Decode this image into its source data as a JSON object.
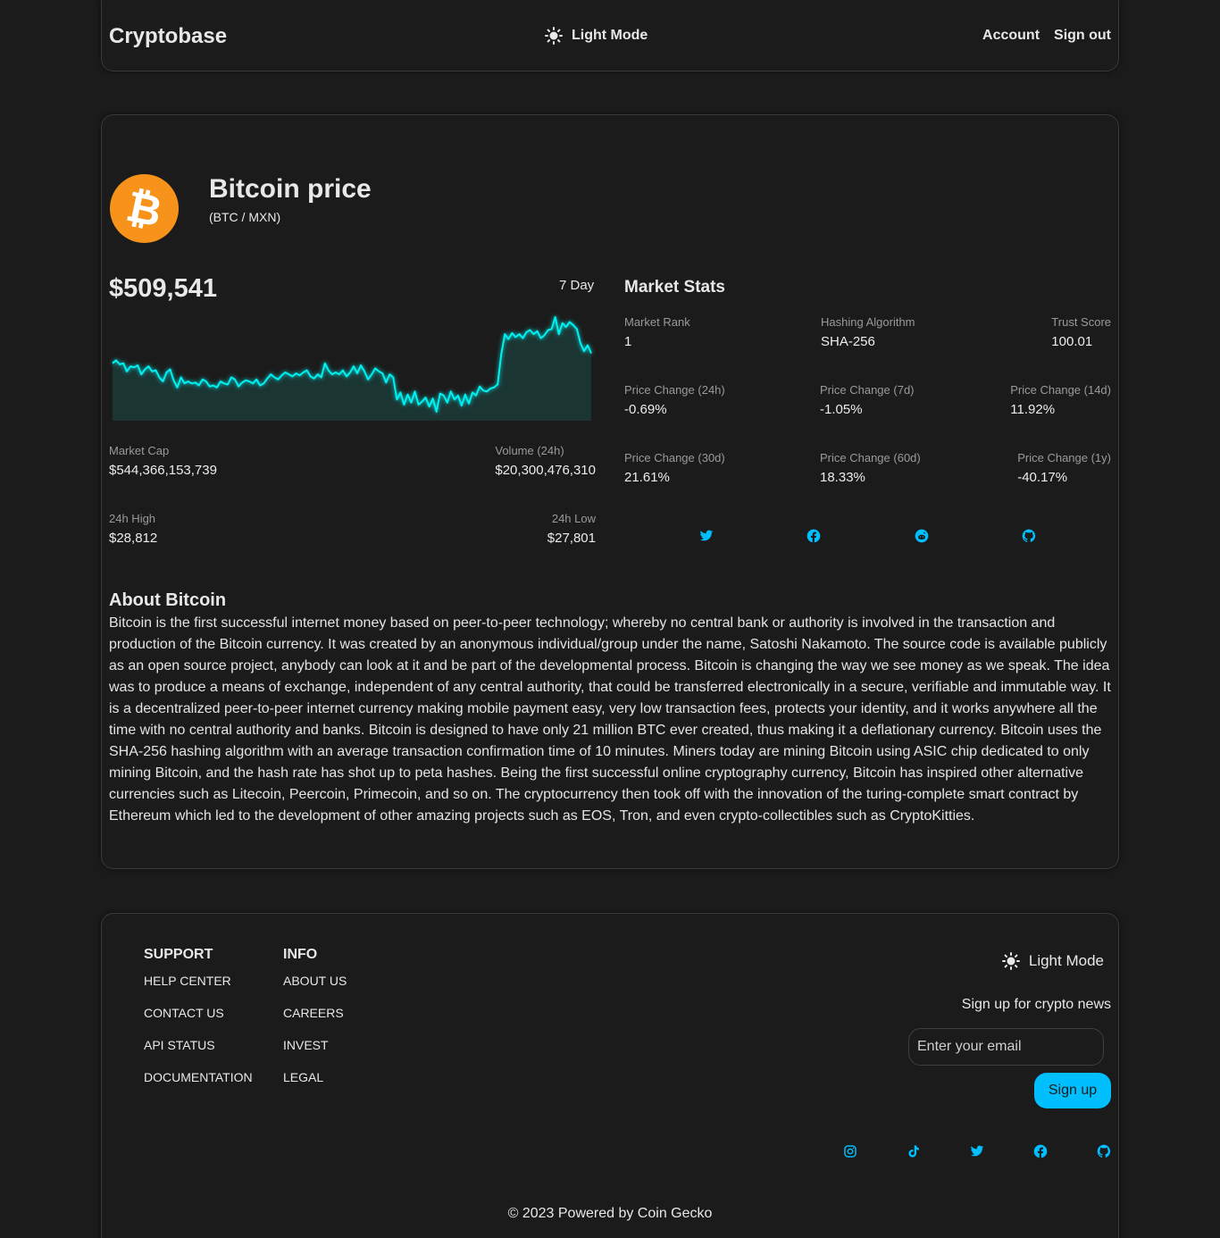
{
  "colors": {
    "accent": "#00bfff",
    "bitcoin": "#f7931a",
    "chart_line": "#00f0f0",
    "chart_fill": "#1b3533",
    "background": "#1b1b1b"
  },
  "header": {
    "brand": "Cryptobase",
    "mode_toggle": "Light Mode",
    "account": "Account",
    "sign_out": "Sign out"
  },
  "coin": {
    "title": "Bitcoin price",
    "pair": "(BTC / MXN)",
    "price": "$509,541",
    "range_label": "7 Day",
    "market_cap_label": "Market Cap",
    "market_cap": "$544,366,153,739",
    "volume_label": "Volume (24h)",
    "volume": "$20,300,476,310",
    "high_label": "24h High",
    "high": "$28,812",
    "low_label": "24h Low",
    "low": "$27,801"
  },
  "chart_data": {
    "type": "area",
    "series": [
      {
        "values": [
          412,
          415,
          411,
          412,
          404,
          409,
          408,
          410,
          401,
          406,
          409,
          404,
          405,
          398,
          394,
          403,
          406,
          395,
          388,
          398,
          392,
          394,
          392,
          393,
          390,
          396,
          394,
          389,
          390,
          388,
          394,
          392,
          391,
          398,
          396,
          389,
          393,
          395,
          394,
          392,
          396,
          390,
          392,
          397,
          401,
          398,
          396,
          400,
          403,
          401,
          399,
          402,
          400,
          403,
          405,
          399,
          397,
          401,
          398,
          412,
          405,
          401,
          403,
          401,
          405,
          399,
          403,
          409,
          402,
          410,
          404,
          396,
          401,
          407,
          404,
          402,
          393,
          401,
          398,
          376,
          383,
          371,
          381,
          373,
          384,
          371,
          374,
          378,
          369,
          377,
          364,
          382,
          380,
          373,
          384,
          376,
          380,
          370,
          381,
          372,
          383,
          380,
          389,
          385,
          384,
          387,
          388,
          391,
          421,
          441,
          436,
          442,
          438,
          441,
          437,
          443,
          445,
          441,
          444,
          437,
          440,
          445,
          446,
          458,
          441,
          452,
          448,
          453,
          450,
          446,
          432,
          424,
          430,
          422
        ]
      }
    ],
    "ylim": [
      355,
      465
    ]
  },
  "market_stats": {
    "title": "Market Stats",
    "rank_label": "Market Rank",
    "rank": "1",
    "algo_label": "Hashing Algorithm",
    "algo": "SHA-256",
    "trust_label": "Trust Score",
    "trust": "100.01",
    "pc24h_label": "Price Change (24h)",
    "pc24h": "-0.69%",
    "pc7d_label": "Price Change (7d)",
    "pc7d": "-1.05%",
    "pc14d_label": "Price Change (14d)",
    "pc14d": "11.92%",
    "pc30d_label": "Price Change (30d)",
    "pc30d": "21.61%",
    "pc60d_label": "Price Change (60d)",
    "pc60d": "18.33%",
    "pc1y_label": "Price Change (1y)",
    "pc1y": "-40.17%"
  },
  "about": {
    "title": "About Bitcoin",
    "text": "Bitcoin is the first successful internet money based on peer-to-peer technology; whereby no central bank or authority is involved in the transaction and production of the Bitcoin currency. It was created by an anonymous individual/group under the name, Satoshi Nakamoto. The source code is available publicly as an open source project, anybody can look at it and be part of the developmental process. Bitcoin is changing the way we see money as we speak. The idea was to produce a means of exchange, independent of any central authority, that could be transferred electronically in a secure, verifiable and immutable way. It is a decentralized peer-to-peer internet currency making mobile payment easy, very low transaction fees, protects your identity, and it works anywhere all the time with no central authority and banks. Bitcoin is designed to have only 21 million BTC ever created, thus making it a deflationary currency. Bitcoin uses the SHA-256 hashing algorithm with an average transaction confirmation time of 10 minutes. Miners today are mining Bitcoin using ASIC chip dedicated to only mining Bitcoin, and the hash rate has shot up to peta hashes. Being the first successful online cryptography currency, Bitcoin has inspired other alternative currencies such as Litecoin, Peercoin, Primecoin, and so on. The cryptocurrency then took off with the innovation of the turing-complete smart contract by Ethereum which led to the development of other amazing projects such as EOS, Tron, and even crypto-collectibles such as CryptoKitties."
  },
  "footer": {
    "support_title": "SUPPORT",
    "support_links": [
      "HELP CENTER",
      "CONTACT US",
      "API STATUS",
      "DOCUMENTATION"
    ],
    "info_title": "INFO",
    "info_links": [
      "ABOUT US",
      "CAREERS",
      "INVEST",
      "LEGAL"
    ],
    "mode_toggle": "Light Mode",
    "news_label": "Sign up for crypto news",
    "email_placeholder": "Enter your email",
    "signup_label": "Sign up",
    "copyright": "© 2023 Powered by Coin Gecko"
  },
  "icons": {
    "coin_socials": [
      "twitter-icon",
      "facebook-icon",
      "reddit-icon",
      "github-icon"
    ],
    "footer_socials": [
      "instagram-icon",
      "tiktok-icon",
      "twitter-icon",
      "facebook-icon",
      "github-icon"
    ]
  }
}
